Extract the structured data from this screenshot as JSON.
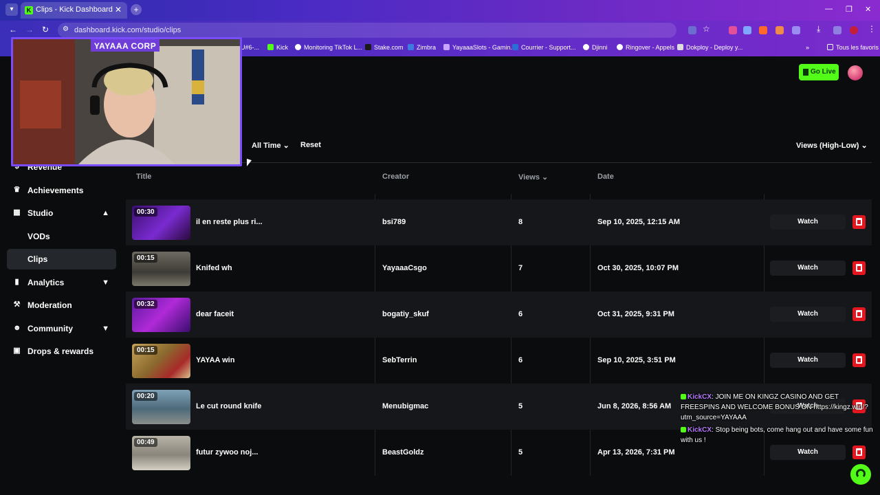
{
  "browser": {
    "tab_title": "Clips - Kick Dashboard",
    "url": "dashboard.kick.com/studio/clips",
    "bookmarks": [
      "U#6-...",
      "Kick",
      "Monitoring TikTok L...",
      "Stake.com",
      "Zimbra",
      "YayaaaSlots - Gamin...",
      "Courrier - Support...",
      "Djinni",
      "Ringover - Appels",
      "Dokploy - Deploy y...",
      "Tous les favoris"
    ]
  },
  "header": {
    "go_live_label": "Go Live"
  },
  "sidebar": {
    "items": [
      {
        "label": "Revenue"
      },
      {
        "label": "Achievements"
      },
      {
        "label": "Studio"
      },
      {
        "label": "VODs"
      },
      {
        "label": "Clips"
      },
      {
        "label": "Analytics"
      },
      {
        "label": "Moderation"
      },
      {
        "label": "Community"
      },
      {
        "label": "Drops & rewards"
      }
    ]
  },
  "filters": {
    "time_range": "All Time",
    "reset_label": "Reset",
    "sort_label": "Views (High-Low)"
  },
  "table": {
    "columns": [
      "Title",
      "Creator",
      "Views",
      "Date"
    ],
    "watch_label": "Watch",
    "rows": [
      {
        "duration": "00:30",
        "title": "il en reste plus ri...",
        "creator": "bsi789",
        "views": "8",
        "date": "Sep 10, 2025, 12:15 AM"
      },
      {
        "duration": "00:15",
        "title": "Knifed wh",
        "creator": "YayaaaCsgo",
        "views": "7",
        "date": "Oct 30, 2025, 10:07 PM"
      },
      {
        "duration": "00:32",
        "title": "dear faceit",
        "creator": "bogatiy_skuf",
        "views": "6",
        "date": "Oct 31, 2025, 9:31 PM"
      },
      {
        "duration": "00:15",
        "title": "YAYAA win",
        "creator": "SebTerrin",
        "views": "6",
        "date": "Sep 10, 2025, 3:51 PM"
      },
      {
        "duration": "00:20",
        "title": "Le cut round knife",
        "creator": "Menubigmac",
        "views": "5",
        "date": "Jun 8, 2026, 8:56 AM"
      },
      {
        "duration": "00:49",
        "title": "futur zywoo noj...",
        "creator": "BeastGoldz",
        "views": "5",
        "date": "Apr 13, 2026, 7:31 PM"
      }
    ]
  },
  "webcam": {
    "label": "YAYAAA CORP"
  },
  "chat": [
    {
      "user": "KickCX",
      "message": ": JOIN ME ON KINGZ CASINO AND GET FREESPINS AND WELCOME BONUS ON https://kingz.win/?utm_source=YAYAAA"
    },
    {
      "user": "KickCX",
      "message": ": Stop being bots, come hang out and have some fun with us !"
    }
  ]
}
